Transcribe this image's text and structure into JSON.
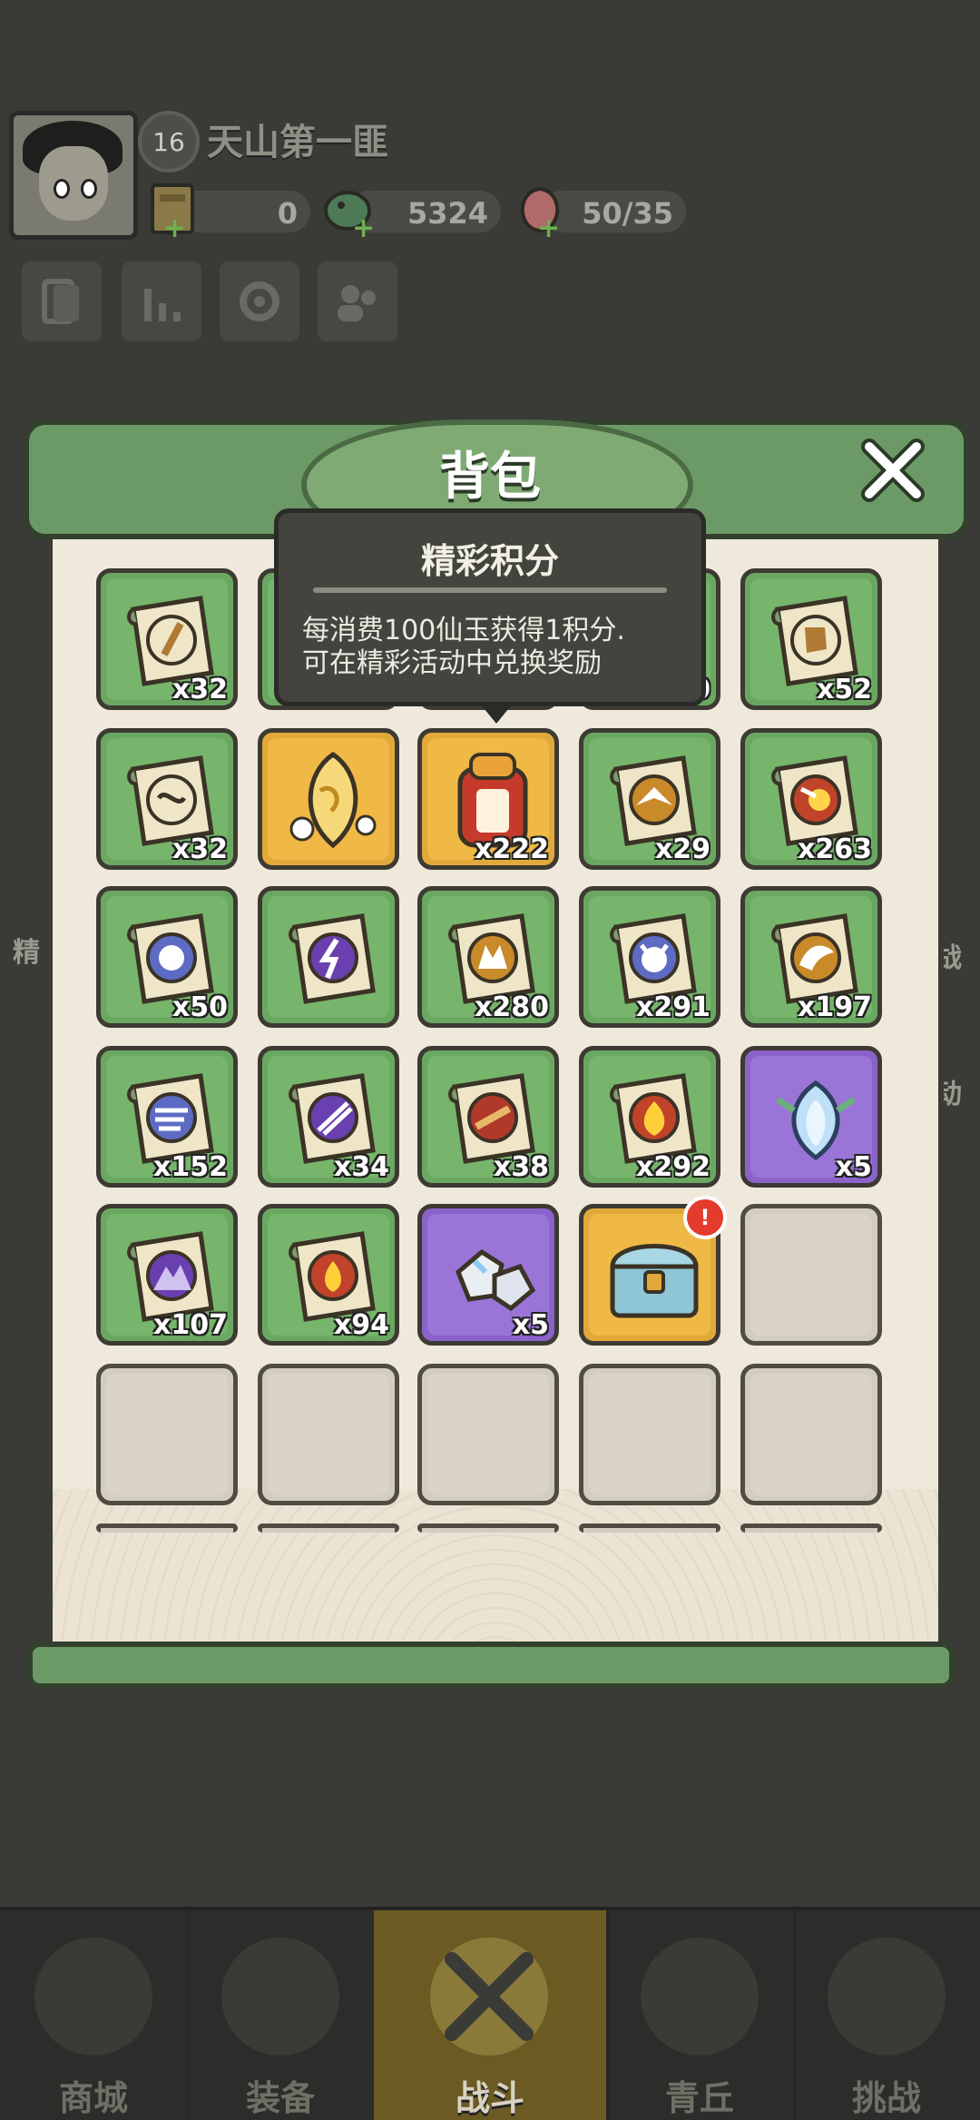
{
  "player": {
    "level": "16",
    "name": "天山第一匪"
  },
  "resources": [
    {
      "icon": "ticket-icon",
      "value": "0"
    },
    {
      "icon": "jade-dragon-icon",
      "value": "5324"
    },
    {
      "icon": "peach-icon",
      "value": "50/35"
    }
  ],
  "side_labels": {
    "left": "精",
    "right_top": "战",
    "right_bottom": "动"
  },
  "panel": {
    "title": "背包"
  },
  "tooltip": {
    "title": "精彩积分",
    "description_line1": "每消费100仙玉获得1积分.",
    "description_line2": "可在精彩活动中兑换奖励"
  },
  "items": [
    {
      "rarity": "green",
      "icon": "scroll-sword-icon",
      "qty": "x32"
    },
    {
      "rarity": "green",
      "icon": "hidden-item",
      "qty": ""
    },
    {
      "rarity": "green",
      "icon": "hidden-item",
      "qty": ""
    },
    {
      "rarity": "green",
      "icon": "hidden-item",
      "qty": "0"
    },
    {
      "rarity": "green",
      "icon": "scroll-boot-icon",
      "qty": "x52"
    },
    {
      "rarity": "green",
      "icon": "scroll-rune-icon",
      "qty": "x32"
    },
    {
      "rarity": "gold",
      "icon": "golden-jade-icon",
      "qty": ""
    },
    {
      "rarity": "gold",
      "icon": "points-token-icon",
      "qty": "x222"
    },
    {
      "rarity": "green",
      "icon": "eagle-skill-icon",
      "qty": "x29"
    },
    {
      "rarity": "green",
      "icon": "fireball-skill-icon",
      "qty": "x263"
    },
    {
      "rarity": "green",
      "icon": "orb-skill-icon",
      "qty": "x50"
    },
    {
      "rarity": "green",
      "icon": "lightning-skill-icon",
      "qty": ""
    },
    {
      "rarity": "green",
      "icon": "wolf-skill-icon",
      "qty": "x280"
    },
    {
      "rarity": "green",
      "icon": "demon-skill-icon",
      "qty": "x291"
    },
    {
      "rarity": "green",
      "icon": "dragon-skill-icon",
      "qty": "x197"
    },
    {
      "rarity": "green",
      "icon": "wind-skill-icon",
      "qty": "x152"
    },
    {
      "rarity": "green",
      "icon": "slash-skill-icon",
      "qty": "x34"
    },
    {
      "rarity": "green",
      "icon": "sword-skill-icon",
      "qty": "x38"
    },
    {
      "rarity": "green",
      "icon": "flame-skill-icon",
      "qty": "x292"
    },
    {
      "rarity": "purple",
      "icon": "crystal-lotus-icon",
      "qty": "x5"
    },
    {
      "rarity": "green",
      "icon": "mountain-skill-icon",
      "qty": "x107"
    },
    {
      "rarity": "green",
      "icon": "fire-skill-icon",
      "qty": "x94"
    },
    {
      "rarity": "purple",
      "icon": "ore-crystal-icon",
      "qty": "x5"
    },
    {
      "rarity": "gold",
      "icon": "treasure-chest-icon",
      "qty": "",
      "alert": "!"
    },
    {
      "rarity": "empty",
      "icon": "",
      "qty": ""
    },
    {
      "rarity": "empty",
      "icon": "",
      "qty": ""
    },
    {
      "rarity": "empty",
      "icon": "",
      "qty": ""
    },
    {
      "rarity": "empty",
      "icon": "",
      "qty": ""
    },
    {
      "rarity": "empty",
      "icon": "",
      "qty": ""
    },
    {
      "rarity": "empty",
      "icon": "",
      "qty": ""
    }
  ],
  "bottom_nav": [
    {
      "label": "商城",
      "icon": "shop-icon"
    },
    {
      "label": "装备",
      "icon": "armor-icon"
    },
    {
      "label": "战斗",
      "icon": "crossed-swords-icon",
      "active": true
    },
    {
      "label": "青丘",
      "icon": "mountain-icon"
    },
    {
      "label": "挑战",
      "icon": "challenge-icon"
    }
  ]
}
